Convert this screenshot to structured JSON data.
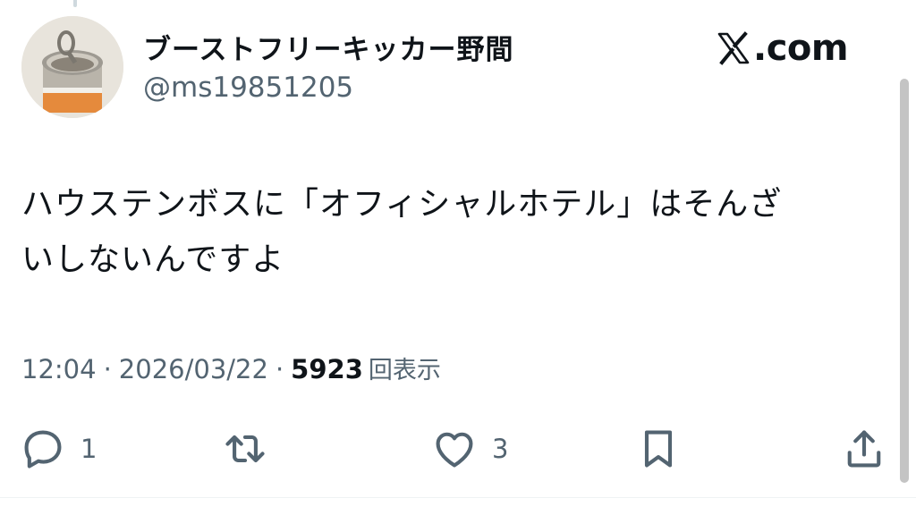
{
  "author": {
    "display_name": "ブーストフリーキッカー野間",
    "handle": "@ms19851205",
    "avatar": "tin-can-photo"
  },
  "brand": {
    "logo": "x-logo-icon",
    "label": ".com"
  },
  "tweet": {
    "text": "ハウステンボスに「オフィシャルホテル」はそんざ\nいしないんですよ",
    "time": "12:04",
    "separator": "·",
    "date": "2026/03/22",
    "views_count": "5923",
    "views_label": "回表示"
  },
  "actions": {
    "reply": {
      "icon": "reply-icon",
      "count": "1"
    },
    "retweet": {
      "icon": "retweet-icon"
    },
    "like": {
      "icon": "heart-icon",
      "count": "3"
    },
    "bookmark": {
      "icon": "bookmark-icon"
    },
    "share": {
      "icon": "share-icon"
    }
  },
  "colors": {
    "text_primary": "#0f1419",
    "text_secondary": "#536471",
    "background": "#ffffff"
  }
}
